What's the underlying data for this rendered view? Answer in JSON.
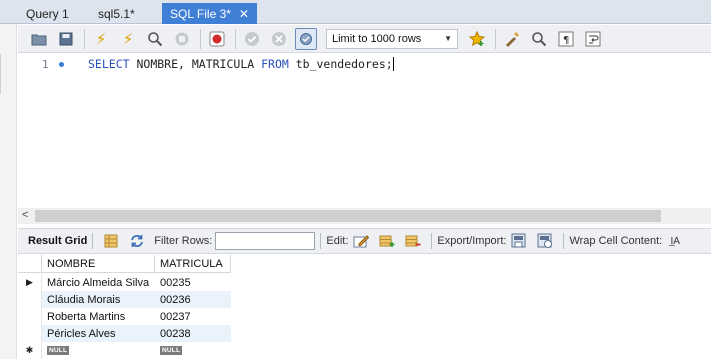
{
  "tabs": [
    {
      "label": "Query 1",
      "active": false
    },
    {
      "label": "sql5.1*",
      "active": false
    },
    {
      "label": "SQL File 3*",
      "active": true
    }
  ],
  "tab_close_glyph": "✕",
  "toolbar": {
    "limit_select_value": "Limit to 1000 rows",
    "icons": [
      "open-folder-icon",
      "save-icon",
      "execute-icon",
      "execute-current-icon",
      "explain-icon",
      "stop-icon",
      "toggle-error-icon",
      "commit-icon",
      "rollback-icon",
      "autocommit-icon",
      "add-snippet-icon",
      "beautify-icon",
      "find-icon",
      "invisible-chars-icon",
      "wrap-icon"
    ]
  },
  "editor": {
    "line_number": "1",
    "code": {
      "kw1": "SELECT",
      "t1": " NOMBRE, MATRICULA ",
      "kw2": "FROM",
      "t2": " tb_vendedores;"
    }
  },
  "result_toolbar": {
    "result_grid_label": "Result Grid",
    "filter_rows_label": "Filter Rows:",
    "filter_value": "",
    "edit_label": "Edit:",
    "export_import_label": "Export/Import:",
    "wrap_label": "Wrap Cell Content:",
    "wrap_icon_glyph": "I̲A"
  },
  "grid": {
    "columns": [
      "NOMBRE",
      "MATRICULA"
    ],
    "rows": [
      {
        "nombre": "Márcio Almeida Silva",
        "matricula": "00235"
      },
      {
        "nombre": "Cláudia Morais",
        "matricula": "00236"
      },
      {
        "nombre": "Roberta Martins",
        "matricula": "00237"
      },
      {
        "nombre": "Péricles Alves",
        "matricula": "00238"
      }
    ],
    "current_row_marker": "▶",
    "new_row_marker": "✱",
    "null_label": "NULL"
  },
  "colors": {
    "active_tab": "#3f7fd6",
    "keyword": "#2a52be",
    "alt_row": "#eaf2fc"
  }
}
